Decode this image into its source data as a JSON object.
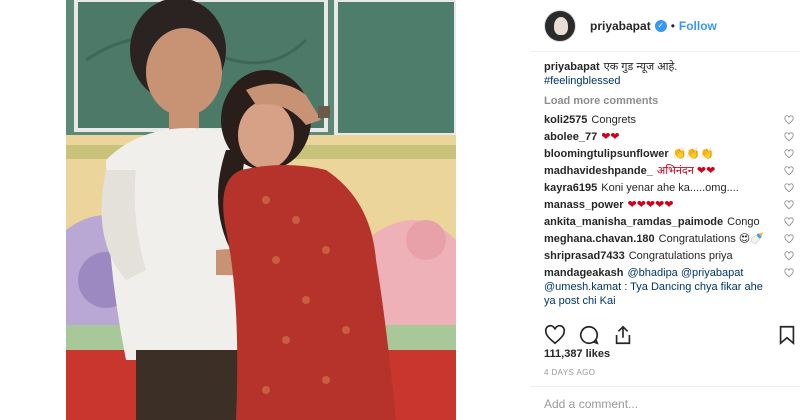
{
  "header": {
    "username": "priyabapat",
    "separator": "•",
    "follow_label": "Follow",
    "verified_glyph": "✓"
  },
  "caption": {
    "username": "priyabapat",
    "text": "एक गुड न्यूज आहे.",
    "hashtag": "#feelingblessed"
  },
  "load_more": "Load more comments",
  "comments": [
    {
      "user": "koli2575",
      "text": "Congrets"
    },
    {
      "user": "abolee_77",
      "text": "❤❤"
    },
    {
      "user": "bloomingtulipsunflower",
      "text": "👏👏👏"
    },
    {
      "user": "madhavideshpande_",
      "text": "अभिनंदन ❤❤"
    },
    {
      "user": "kayra6195",
      "text": "Koni yenar ahe ka.....omg...."
    },
    {
      "user": "manass_power",
      "text": "❤❤❤❤❤"
    },
    {
      "user": "ankita_manisha_ramdas_paimode",
      "text": "Congo"
    },
    {
      "user": "meghana.chavan.180",
      "text": "Congratulations 😍🍼"
    },
    {
      "user": "shriprasad7433",
      "text": "Congratulations priya"
    },
    {
      "user": "mandageakash",
      "text": "@bhadipa @priyabapat @umesh.kamat : Tya Dancing chya fikar ahe ya post chi Kai"
    }
  ],
  "likes": "111,387 likes",
  "age": "4 DAYS AGO",
  "add_comment_placeholder": "Add a comment...",
  "icons": {
    "like": "heart-outline-icon",
    "comment": "speech-bubble-icon",
    "share": "share-icon",
    "save": "bookmark-icon",
    "verified": "verified-badge-icon"
  },
  "colors": {
    "accent": "#3897f0",
    "hashtag": "#003569",
    "muted": "#8e8e8e",
    "heart": "#d0021b"
  }
}
